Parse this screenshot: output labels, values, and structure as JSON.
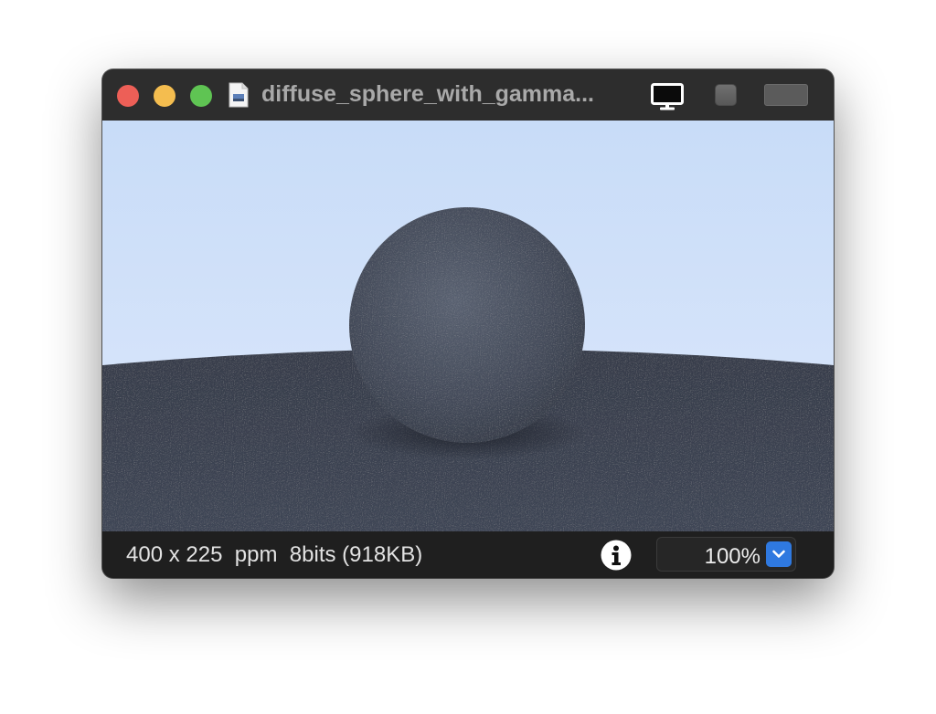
{
  "window": {
    "title": "diffuse_sphere_with_gamma..."
  },
  "titlebar": {
    "buttons": [
      "close",
      "minimize",
      "zoom"
    ],
    "icons": [
      "document-icon",
      "monitor-icon",
      "square-button",
      "rect-button"
    ]
  },
  "image": {
    "description_hidden": false,
    "colors": {
      "sky_top": "#c8dcf8",
      "sky_bottom": "#dbe7fb",
      "ground": "#3a4150",
      "sphere": "#4a5262"
    }
  },
  "statusbar": {
    "dimensions": "400 x 225",
    "format": "ppm",
    "bits": "8bits",
    "size": "(918KB)",
    "zoom": "100%"
  }
}
